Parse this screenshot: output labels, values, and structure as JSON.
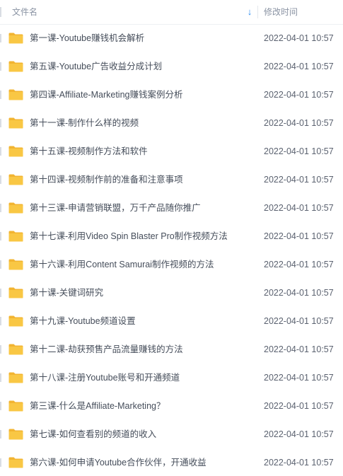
{
  "header": {
    "name_label": "文件名",
    "sort_icon": "arrow-down-icon",
    "time_label": "修改时间"
  },
  "colors": {
    "folder": "#f9c744",
    "folder_tab": "#f2b431",
    "sort_arrow": "#2f8cf0"
  },
  "files": [
    {
      "name": "第一课-Youtube赚钱机会解析",
      "modified": "2022-04-01 10:57"
    },
    {
      "name": "第五课-Youtube广告收益分成计划",
      "modified": "2022-04-01 10:57"
    },
    {
      "name": "第四课-Affiliate-Marketing赚钱案例分析",
      "modified": "2022-04-01 10:57"
    },
    {
      "name": "第十一课-制作什么样的视频",
      "modified": "2022-04-01 10:57"
    },
    {
      "name": "第十五课-视频制作方法和软件",
      "modified": "2022-04-01 10:57"
    },
    {
      "name": "第十四课-视频制作前的准备和注意事项",
      "modified": "2022-04-01 10:57"
    },
    {
      "name": "第十三课-申请营销联盟，万千产品随你推广",
      "modified": "2022-04-01 10:57"
    },
    {
      "name": "第十七课-利用Video Spin Blaster Pro制作视频方法",
      "modified": "2022-04-01 10:57"
    },
    {
      "name": "第十六课-利用Content Samurai制作视频的方法",
      "modified": "2022-04-01 10:57"
    },
    {
      "name": "第十课-关键词研究",
      "modified": "2022-04-01 10:57"
    },
    {
      "name": "第十九课-Youtube频道设置",
      "modified": "2022-04-01 10:57"
    },
    {
      "name": "第十二课-劫获预售产品流量赚钱的方法",
      "modified": "2022-04-01 10:57"
    },
    {
      "name": "第十八课-注册Youtube账号和开通频道",
      "modified": "2022-04-01 10:57"
    },
    {
      "name": "第三课-什么是Affiliate-Marketing？",
      "modified": "2022-04-01 10:57"
    },
    {
      "name": "第七课-如何查看别的频道的收入",
      "modified": "2022-04-01 10:57"
    },
    {
      "name": "第六课-如何申请Youtube合作伙伴，开通收益",
      "modified": "2022-04-01 10:57"
    }
  ]
}
